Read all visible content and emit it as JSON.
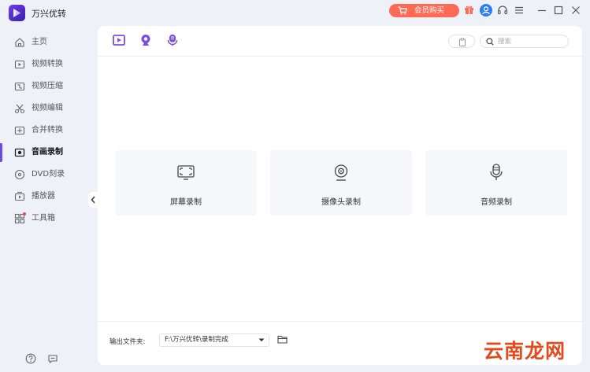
{
  "app": {
    "title": "万兴优转"
  },
  "header": {
    "vip_label": "会员购买"
  },
  "sidebar": {
    "items": [
      {
        "label": "主页"
      },
      {
        "label": "视频转换"
      },
      {
        "label": "视频压缩"
      },
      {
        "label": "视频编辑"
      },
      {
        "label": "合并转换"
      },
      {
        "label": "音画录制",
        "active": true
      },
      {
        "label": "DVD刻录"
      },
      {
        "label": "播放器"
      },
      {
        "label": "工具箱",
        "badge": true
      }
    ]
  },
  "main": {
    "search_placeholder": "搜索",
    "cards": [
      {
        "label": "屏幕录制",
        "icon": "screen-record-icon"
      },
      {
        "label": "摄像头录制",
        "icon": "webcam-icon"
      },
      {
        "label": "音频录制",
        "icon": "microphone-icon"
      }
    ],
    "output": {
      "label": "输出文件夹:",
      "path": "F:\\万兴优转\\录制完成"
    }
  },
  "watermark": "云南龙网",
  "colors": {
    "accent": "#6b4de6",
    "vip": "#ff6a55",
    "user": "#2b7cf6",
    "watermark": "#e04b1e"
  }
}
